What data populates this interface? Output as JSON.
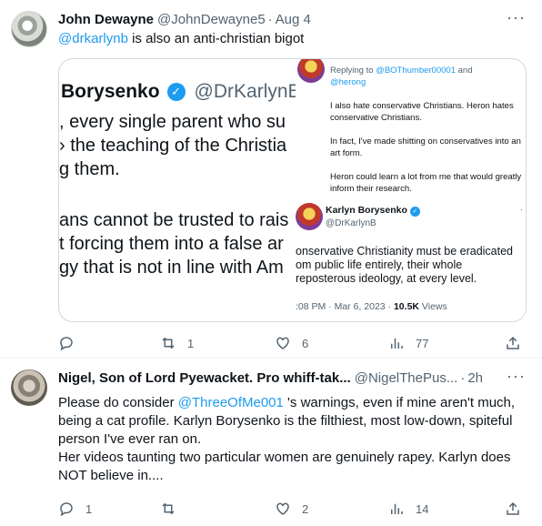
{
  "tweet1": {
    "name": "John Dewayne",
    "handle": "@JohnDewayne5",
    "time": "Aug 4",
    "more": "···",
    "text_mention": "@drkarlynb",
    "text_rest": " is also an anti-christian bigot",
    "media": {
      "big_name": "Borysenko",
      "big_handle": "@DrKarlynB",
      "big_lines": [
        ", every single parent who su",
        "› the teaching of the Christia",
        "g them.",
        "ans cannot be trusted to rais",
        "t forcing them into a false ar",
        "ɡy that is not in line with Am"
      ],
      "reply_prefix": "Replying to ",
      "reply_to_1": "@BOThumber00001",
      "reply_and": " and",
      "reply_to_2": "@herong",
      "reply_p1": "I also hate conservative Christians. Heron hates conservative Christians.",
      "reply_p2": "In fact, I've made shitting on conservatives into an art form.",
      "reply_p3": "Heron could learn a lot from me that would greatly inform their research.",
      "kb_name": "Karlyn Borysenko",
      "kb_handle": "@DrKarlynB",
      "kb_dots": "·",
      "kb_lines": [
        "onservative Christianity must be eradicated",
        "om public life entirely, their whole",
        "reposterous ideology, at every level."
      ],
      "kb_meta": ":08 PM · Mar 6, 2023 · ",
      "kb_views_count": "10.5K",
      "kb_views_label": " Views"
    },
    "actions": {
      "replies": "",
      "retweets": "1",
      "likes": "6",
      "views": "77"
    }
  },
  "tweet2": {
    "name": "Nigel, Son of Lord Pyewacket. Pro whiff-tak...",
    "handle": "@NigelThePus...",
    "time": "2h",
    "more": "···",
    "text_a": "Please do consider ",
    "text_mention": "@ThreeOfMe001",
    "text_b": " 's warnings, even if mine aren't much, being a cat profile.  Karlyn Borysenko is the filthiest, most low-down, spiteful person I've ever ran on.",
    "text_c": "Her videos taunting two particular women are genuinely rapey.  Karlyn does NOT believe in....",
    "actions": {
      "replies": "1",
      "retweets": "",
      "likes": "2",
      "views": "14"
    }
  },
  "colors": {
    "accent": "#1d9bf0",
    "text": "#0f1419",
    "muted": "#536471",
    "border": "#cfd9de"
  },
  "icons": [
    "reply-icon",
    "retweet-icon",
    "like-icon",
    "views-icon",
    "share-icon",
    "more-icon",
    "verified-icon"
  ]
}
